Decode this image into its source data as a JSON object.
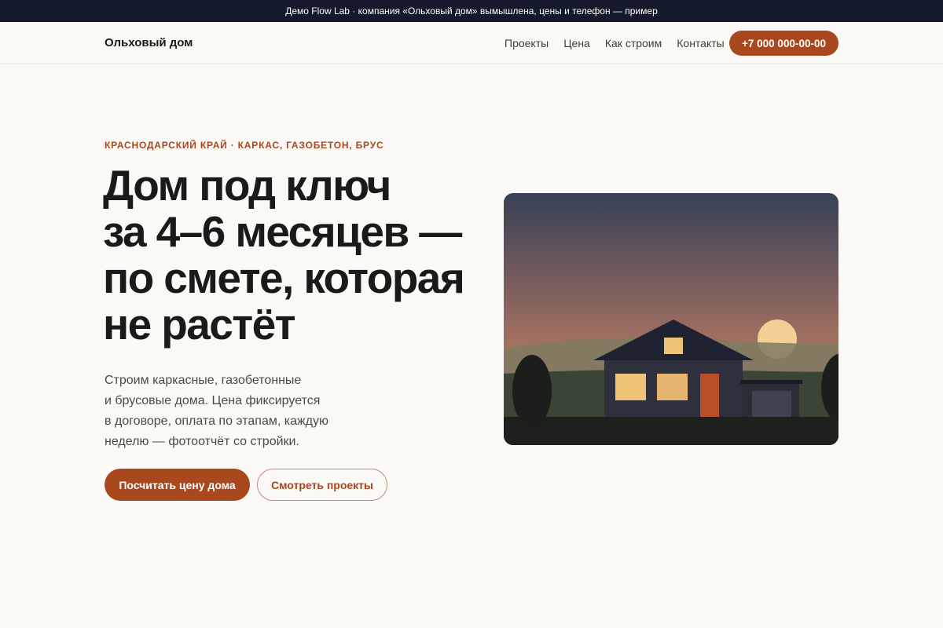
{
  "demo_banner": {
    "text": "Демо Flow Lab · компания «Ольховый дом» вымышлена, цены и телефон — пример"
  },
  "header": {
    "logo": "Ольховый дом",
    "nav": [
      {
        "label": "Проекты"
      },
      {
        "label": "Цена"
      },
      {
        "label": "Как строим"
      },
      {
        "label": "Контакты"
      }
    ],
    "phone_button": "+7 000 000-00-00"
  },
  "hero": {
    "kicker": "КРАСНОДАРСКИЙ КРАЙ · КАРКАС, ГАЗОБЕТОН, БРУС",
    "headline_lines": [
      "Дом под ключ",
      "за 4–6 месяцев —",
      "по смете, которая",
      "не растёт"
    ],
    "lead_lines": [
      "Строим каркасные, газобетонные",
      "и брусовые дома. Цена фиксируется",
      "в договоре, оплата по этапам, каждую",
      "неделю — фотоотчёт со стройки."
    ],
    "primary_cta": "Посчитать цену дома",
    "secondary_cta": "Смотреть проекты"
  },
  "illustration": {
    "icon": "house-at-sunset-illustration",
    "colors": {
      "sky_top": "#364156",
      "sky_bottom": "#d2875c",
      "sun": "#f1cf95",
      "hills": "#7f7a61",
      "meadow": "#3a4536",
      "ground": "#1d201c",
      "house_wall": "#2e313d",
      "roof": "#1f2231",
      "window": "#f0c477",
      "door": "#b94f27",
      "garage_door": "#3f4350",
      "tree": "#1b1e1a"
    }
  },
  "theme": {
    "accent": "#a9471e",
    "page_bg": "#fbf9f5",
    "demo_bar_bg": "#141a2b"
  }
}
